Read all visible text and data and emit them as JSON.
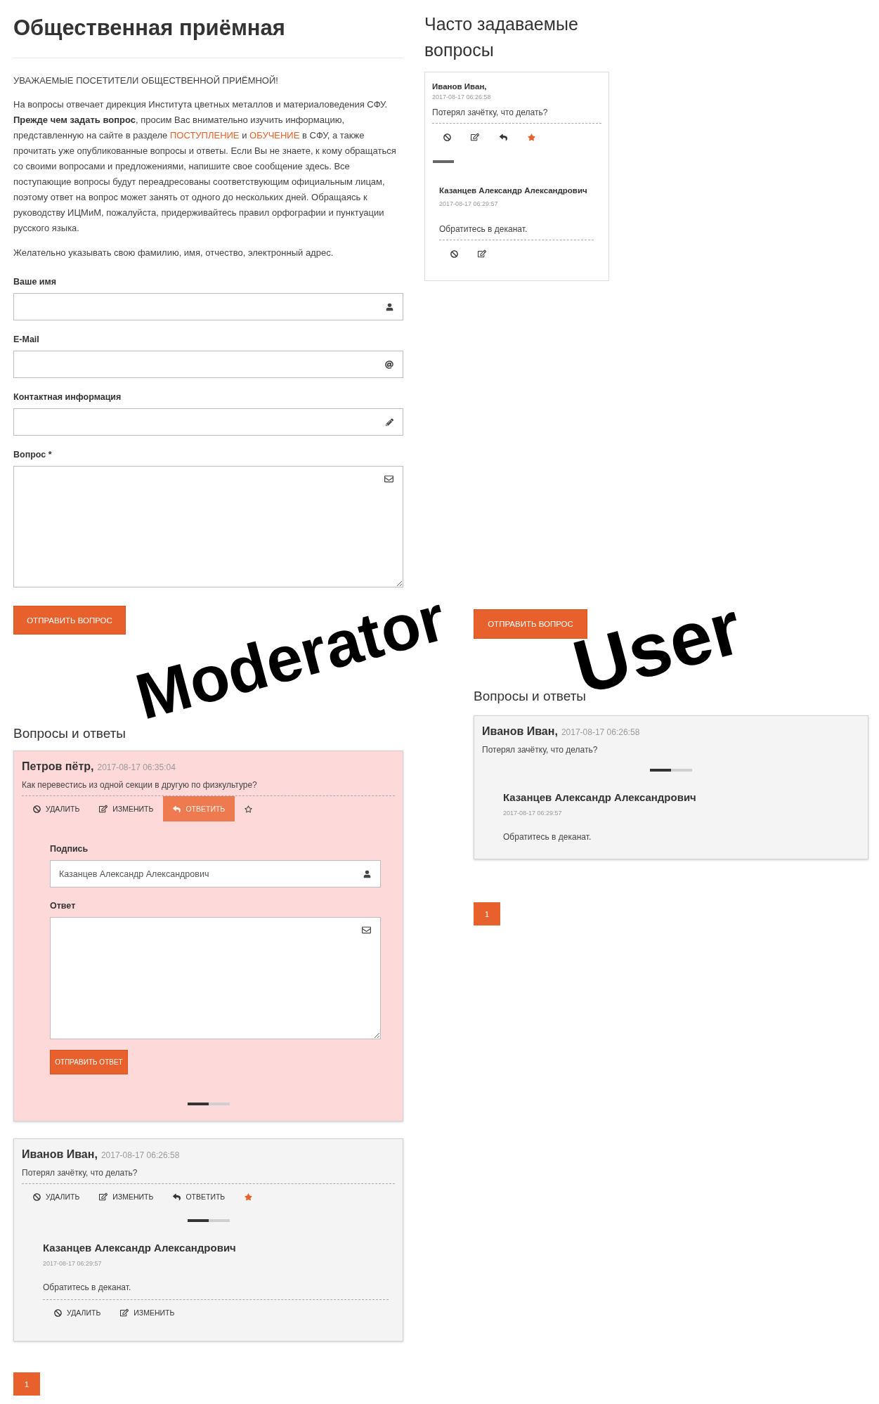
{
  "page_title": "Общественная приёмная",
  "intro": {
    "greeting": "УВАЖАЕМЫЕ ПОСЕТИТЕЛИ ОБЩЕСТВЕННОЙ ПРИЁМНОЙ!",
    "paragraph": [
      {
        "kind": "text",
        "text": "На вопросы отвечает дирекция Института цветных металлов и материаловедения СФУ. **Прежде чем задать вопрос**, просим Вас внимательно изучить информацию, представленную на сайте в разделе "
      },
      {
        "kind": "link",
        "text": "ПОСТУПЛЕНИЕ"
      },
      {
        "kind": "text",
        "text": " и "
      },
      {
        "kind": "link",
        "text": "ОБУЧЕНИЕ"
      },
      {
        "kind": "text",
        "text": " в СФУ, а также прочитать уже опубликованные вопросы и ответы. Если Вы не знаете, к кому обращаться со своими вопросами и предложениями, напишите свое сообщение здесь. Все поступающие вопросы будут переадресованы соответствующим официальным лицам, поэтому ответ на вопрос может занять от одного до нескольких дней. Обращаясь к руководству ИЦМиМ, пожалуйста, придерживайтесь правил орфографии и пунктуации русского языка."
      }
    ],
    "note": "Желательно указывать свою фамилию, имя, отчество, электронный адрес."
  },
  "faq": {
    "heading": "Часто задаваемые вопросы",
    "items": [
      {
        "author": "Иванов Иван,",
        "date": "2017-08-17 06:26:58",
        "text": "Потерял зачётку, что делать?",
        "actions": [
          {
            "kind": "delete",
            "active": false
          },
          {
            "kind": "edit",
            "active": false
          },
          {
            "kind": "reply",
            "active": false
          },
          {
            "kind": "favorite",
            "active": true
          }
        ],
        "answers": [
          {
            "author": "Казанцев Александр Александрович",
            "date": "2017-08-17 06:29:57",
            "text": "Обратитесь в деканат.",
            "actions": [
              {
                "kind": "delete",
                "active": false
              },
              {
                "kind": "edit",
                "active": false
              }
            ]
          }
        ]
      }
    ]
  },
  "form": {
    "fields": [
      {
        "kind": "name",
        "label": "Ваше имя"
      },
      {
        "kind": "email",
        "label": "E-Mail"
      },
      {
        "kind": "contact",
        "label": "Контактная информация"
      },
      {
        "kind": "message",
        "label": "Вопрос *"
      }
    ],
    "submit": "ОТПРАВИТЬ ВОПРОС"
  },
  "moderator_qa": {
    "heading": "Вопросы и ответы",
    "items": [
      {
        "highlighted": true,
        "author": "Петров пётр,",
        "date": "2017-08-17 06:35:04",
        "text": "Как перевестись из одной секции в другую по физкультуре?",
        "actions": [
          {
            "kind": "delete",
            "label": "УДАЛИТЬ",
            "active": false
          },
          {
            "kind": "edit",
            "label": "ИЗМЕНИТЬ",
            "active": false
          },
          {
            "kind": "reply",
            "label": "ОТВЕТИТЬ",
            "active": true
          },
          {
            "kind": "favorite",
            "active": false
          }
        ],
        "reply_form": {
          "signature_label": "Подпись",
          "signature_value": "Казанцев Александр Александрович",
          "answer_label": "Ответ",
          "submit": "ОТПРАВИТЬ ОТВЕТ"
        }
      },
      {
        "highlighted": false,
        "author": "Иванов Иван,",
        "date": "2017-08-17 06:26:58",
        "text": "Потерял зачётку, что делать?",
        "actions": [
          {
            "kind": "delete",
            "label": "УДАЛИТЬ",
            "active": false
          },
          {
            "kind": "edit",
            "label": "ИЗМЕНИТЬ",
            "active": false
          },
          {
            "kind": "reply",
            "label": "ОТВЕТИТЬ",
            "active": false
          },
          {
            "kind": "favorite",
            "active": true
          }
        ],
        "answers": [
          {
            "author": "Казанцев Александр Александрович",
            "date": "2017-08-17 06:29:57",
            "text": "Обратитесь в деканат.",
            "actions": [
              {
                "kind": "delete",
                "label": "УДАЛИТЬ",
                "active": false
              },
              {
                "kind": "edit",
                "label": "ИЗМЕНИТЬ",
                "active": false
              }
            ]
          }
        ]
      }
    ],
    "pagination": [
      {
        "label": "1",
        "selected": true
      }
    ]
  },
  "user_view": {
    "submit": "ОТПРАВИТЬ ВОПРОС",
    "heading": "Вопросы и ответы",
    "items": [
      {
        "highlighted": false,
        "author": "Иванов Иван,",
        "date": "2017-08-17 06:26:58",
        "text": "Потерял зачётку, что делать?",
        "answers": [
          {
            "author": "Казанцев Александр Александрович",
            "date": "2017-08-17 06:29:57",
            "text": "Обратитесь в деканат."
          }
        ]
      }
    ],
    "pagination": [
      {
        "label": "1",
        "selected": true
      }
    ]
  },
  "annotations": [
    {
      "text": "Moderator"
    },
    {
      "text": "User"
    }
  ]
}
